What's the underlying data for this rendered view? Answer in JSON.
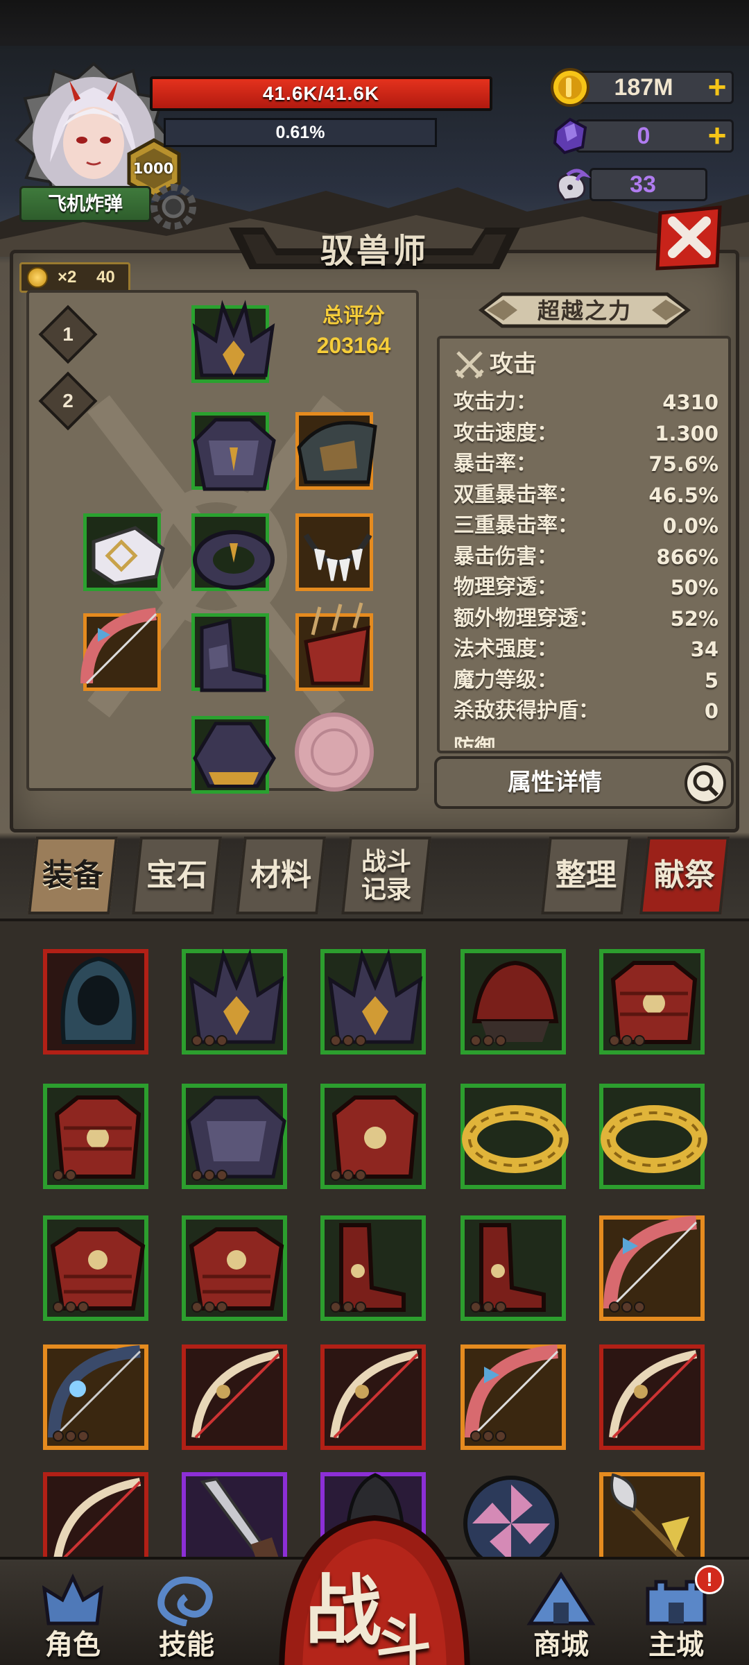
{
  "player": {
    "name": "飞机炸弹",
    "level": "1000",
    "hp_text": "41.6K/41.6K",
    "hp_fraction": 1.0,
    "xp_text": "0.61%",
    "xp_fraction": 0.0061
  },
  "resources": {
    "gold": "187M",
    "gems": "0",
    "rams": "33",
    "plus": "+"
  },
  "class_panel": {
    "title": "驭兽师",
    "multiplier": "×2",
    "multiplier_count": "40",
    "slot_1": "1",
    "slot_2": "2",
    "score_label": "总评分",
    "score_value": "203164",
    "transcend": "超越之力",
    "stats_header": "攻击",
    "stats": [
      {
        "k": "攻击力：",
        "v": "4310"
      },
      {
        "k": "攻击速度：",
        "v": "1.300"
      },
      {
        "k": "暴击率：",
        "v": "75.6%"
      },
      {
        "k": "双重暴击率：",
        "v": "46.5%"
      },
      {
        "k": "三重暴击率：",
        "v": "0.0%"
      },
      {
        "k": "暴击伤害：",
        "v": "866%"
      },
      {
        "k": "物理穿透：",
        "v": "50%"
      },
      {
        "k": "额外物理穿透：",
        "v": "52%"
      },
      {
        "k": "法术强度：",
        "v": "34"
      },
      {
        "k": "魔力等级：",
        "v": "5"
      },
      {
        "k": "杀敌获得护盾：",
        "v": "0"
      }
    ],
    "stats_cut_off": "防御",
    "detail_button": "属性详情"
  },
  "tabs": {
    "equipment": "装备",
    "gems": "宝石",
    "materials": "材料",
    "battle_log_1": "战斗",
    "battle_log_2": "记录",
    "sort": "整理",
    "sacrifice": "献祭"
  },
  "nav": {
    "character": "角色",
    "skills": "技能",
    "battle_1": "战",
    "battle_2": "斗",
    "shop": "商城",
    "main_city": "主城",
    "notice": "!"
  },
  "colors": {
    "hp": "#d9281a",
    "quality_green": "#2aa12f",
    "quality_orange": "#e58b1f",
    "quality_red": "#b22016",
    "quality_purple": "#8c2fd6",
    "score": "#f5cd3a",
    "coin_gold": "#f5c518"
  },
  "icons": {
    "gold": "gold-coin-icon",
    "gems": "purple-crystal-icon",
    "rams": "ram-skull-icon",
    "close": "close-x-icon",
    "search": "magnifier-icon",
    "attack": "crossed-swords-icon"
  }
}
